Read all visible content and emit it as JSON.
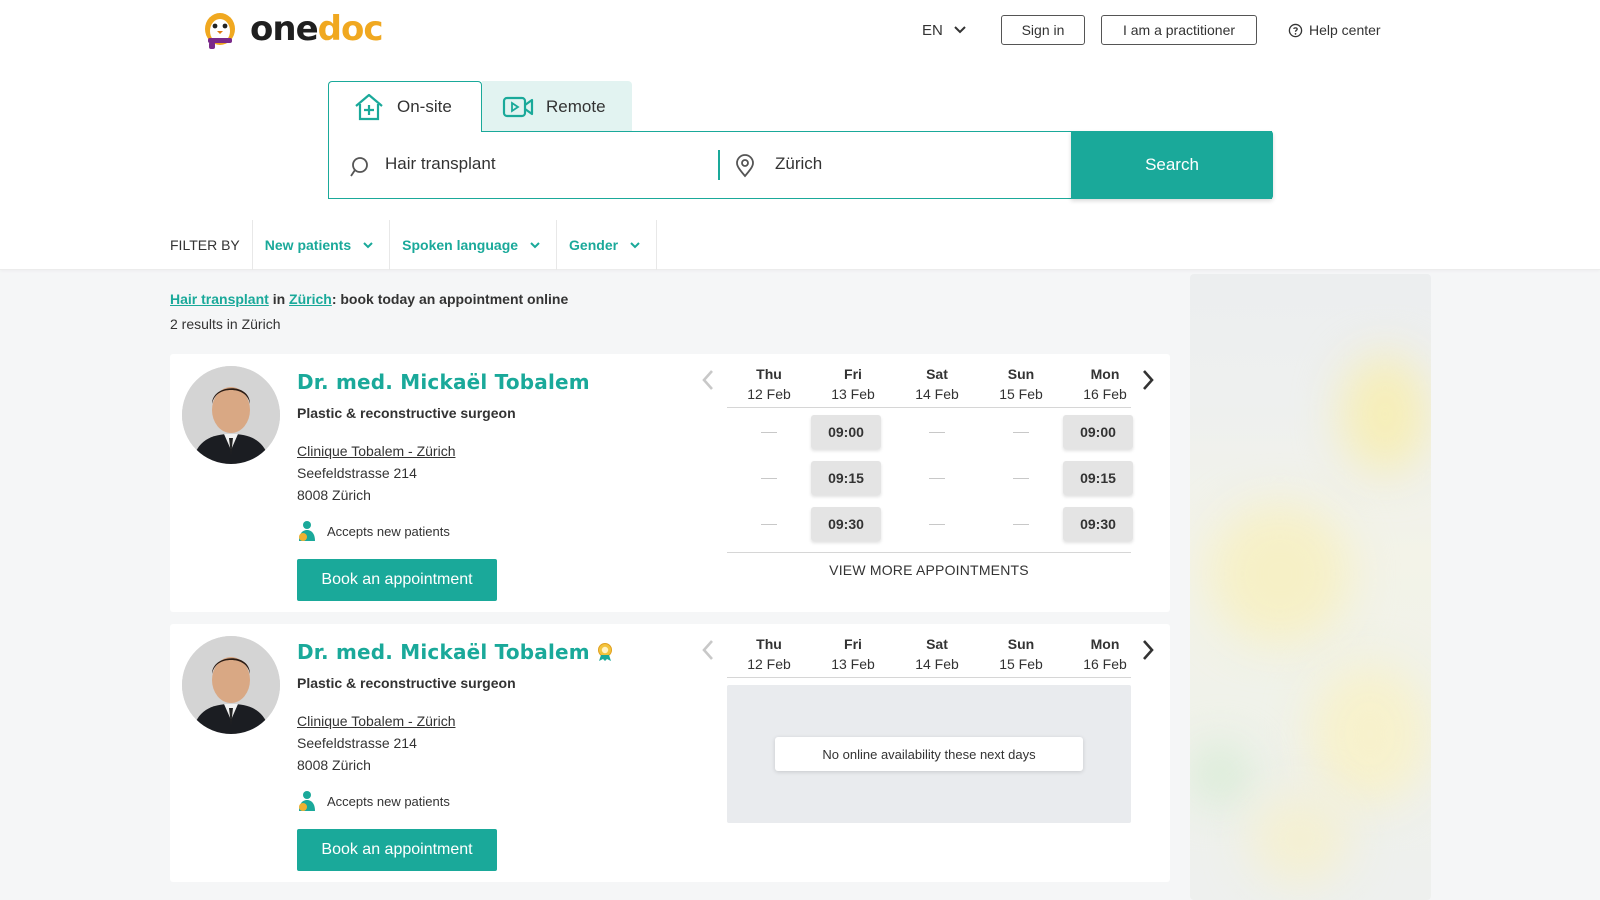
{
  "header": {
    "logo": {
      "part1": "one",
      "part2": "doc"
    },
    "language": "EN",
    "sign_in": "Sign in",
    "practitioner": "I am a practitioner",
    "help": "Help center"
  },
  "search": {
    "tabs": [
      {
        "label": "On-site",
        "icon": "house-plus-icon",
        "active": true
      },
      {
        "label": "Remote",
        "icon": "video-camera-icon",
        "active": false
      }
    ],
    "what_value": "Hair transplant",
    "where_value": "Zürich",
    "button": "Search",
    "accent_color": "#1aa99a"
  },
  "filters": {
    "label": "FILTER BY",
    "items": [
      "New patients",
      "Spoken language",
      "Gender"
    ]
  },
  "results": {
    "breadcrumb": {
      "specialty_link": "Hair transplant",
      "in": " in ",
      "city_link": "Zürich",
      "suffix": ": book today an appointment online"
    },
    "count": "2 results in Zürich"
  },
  "days": [
    {
      "name": "Thu",
      "date": "12 Feb"
    },
    {
      "name": "Fri",
      "date": "13 Feb"
    },
    {
      "name": "Sat",
      "date": "14 Feb"
    },
    {
      "name": "Sun",
      "date": "15 Feb"
    },
    {
      "name": "Mon",
      "date": "16 Feb"
    }
  ],
  "doctors": [
    {
      "name": "Dr. med. Mickaël Tobalem",
      "specialty": "Plastic & reconstructive surgeon",
      "clinic": "Clinique Tobalem - Zürich",
      "street": "Seefeldstrasse 214",
      "city": "8008 Zürich",
      "accepts": "Accepts new patients",
      "book": "Book an appointment",
      "slots": {
        "Fri": [
          "09:00",
          "09:15",
          "09:30"
        ],
        "Mon": [
          "09:00",
          "09:15",
          "09:30"
        ]
      },
      "view_more": "VIEW MORE APPOINTMENTS"
    },
    {
      "name": "Dr. med. Mickaël Tobalem",
      "badge": "award-badge-icon",
      "specialty": "Plastic & reconstructive surgeon",
      "clinic": "Clinique Tobalem - Zürich",
      "street": "Seefeldstrasse 214",
      "city": "8008 Zürich",
      "accepts": "Accepts new patients",
      "book": "Book an appointment",
      "no_availability": "No online availability these next days"
    }
  ]
}
